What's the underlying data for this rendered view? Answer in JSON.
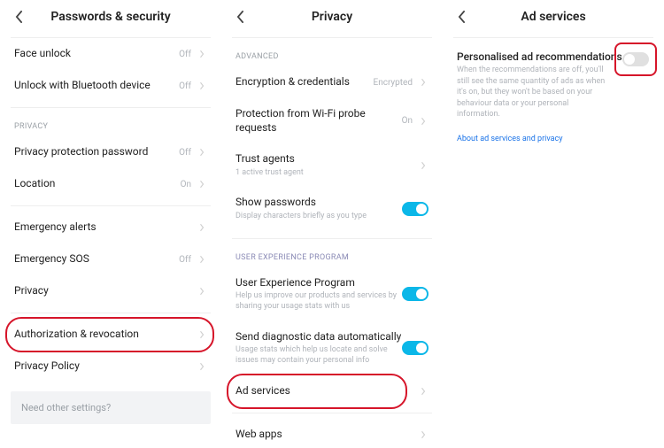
{
  "colors": {
    "accent": "#0bb7e8",
    "highlight": "#d6152a"
  },
  "panel1": {
    "title": "Passwords & security",
    "rows": {
      "face": {
        "label": "Face unlock",
        "value": "Off"
      },
      "bt": {
        "label": "Unlock with Bluetooth device",
        "value": "Off"
      },
      "section_privacy": "PRIVACY",
      "ppp": {
        "label": "Privacy protection password",
        "value": "Off"
      },
      "loc": {
        "label": "Location",
        "value": "On"
      },
      "emerg_alerts": {
        "label": "Emergency alerts"
      },
      "emerg_sos": {
        "label": "Emergency SOS",
        "value": "Off"
      },
      "privacy": {
        "label": "Privacy"
      },
      "auth": {
        "label": "Authorization & revocation"
      },
      "policy": {
        "label": "Privacy Policy"
      }
    },
    "footer": "Need other settings?"
  },
  "panel2": {
    "title": "Privacy",
    "section_advanced": "ADVANCED",
    "rows": {
      "enc": {
        "label": "Encryption & credentials",
        "value": "Encrypted"
      },
      "wifi": {
        "label": "Protection from Wi-Fi probe requests",
        "value": "On"
      },
      "trust": {
        "label": "Trust agents",
        "sub": "1 active trust agent"
      },
      "showpw": {
        "label": "Show passwords",
        "sub": "Display characters briefly as you type"
      },
      "section_uep": "USER EXPERIENCE PROGRAM",
      "uep": {
        "label": "User Experience Program",
        "sub": "Help us improve our products and services by sharing your usage stats with us"
      },
      "diag": {
        "label": "Send diagnostic data automatically",
        "sub": "Usage stats which help us locate and solve issues may contain your personal info"
      },
      "ads": {
        "label": "Ad services"
      },
      "web": {
        "label": "Web apps"
      }
    }
  },
  "panel3": {
    "title": "Ad services",
    "heading": "Personalised ad recommendations",
    "desc": "When the recommendations are off, you'll still see the same quantity of ads as when it's on, but they won't be based on your behaviour data or your personal information.",
    "link": "About ad services and privacy"
  }
}
